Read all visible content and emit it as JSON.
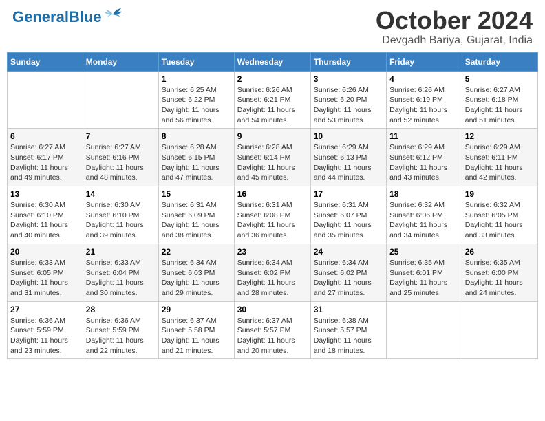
{
  "header": {
    "logo_general": "General",
    "logo_blue": "Blue",
    "title": "October 2024",
    "location": "Devgadh Bariya, Gujarat, India"
  },
  "calendar": {
    "days_of_week": [
      "Sunday",
      "Monday",
      "Tuesday",
      "Wednesday",
      "Thursday",
      "Friday",
      "Saturday"
    ],
    "weeks": [
      [
        {
          "day": "",
          "sunrise": "",
          "sunset": "",
          "daylight": ""
        },
        {
          "day": "",
          "sunrise": "",
          "sunset": "",
          "daylight": ""
        },
        {
          "day": "1",
          "sunrise": "Sunrise: 6:25 AM",
          "sunset": "Sunset: 6:22 PM",
          "daylight": "Daylight: 11 hours and 56 minutes."
        },
        {
          "day": "2",
          "sunrise": "Sunrise: 6:26 AM",
          "sunset": "Sunset: 6:21 PM",
          "daylight": "Daylight: 11 hours and 54 minutes."
        },
        {
          "day": "3",
          "sunrise": "Sunrise: 6:26 AM",
          "sunset": "Sunset: 6:20 PM",
          "daylight": "Daylight: 11 hours and 53 minutes."
        },
        {
          "day": "4",
          "sunrise": "Sunrise: 6:26 AM",
          "sunset": "Sunset: 6:19 PM",
          "daylight": "Daylight: 11 hours and 52 minutes."
        },
        {
          "day": "5",
          "sunrise": "Sunrise: 6:27 AM",
          "sunset": "Sunset: 6:18 PM",
          "daylight": "Daylight: 11 hours and 51 minutes."
        }
      ],
      [
        {
          "day": "6",
          "sunrise": "Sunrise: 6:27 AM",
          "sunset": "Sunset: 6:17 PM",
          "daylight": "Daylight: 11 hours and 49 minutes."
        },
        {
          "day": "7",
          "sunrise": "Sunrise: 6:27 AM",
          "sunset": "Sunset: 6:16 PM",
          "daylight": "Daylight: 11 hours and 48 minutes."
        },
        {
          "day": "8",
          "sunrise": "Sunrise: 6:28 AM",
          "sunset": "Sunset: 6:15 PM",
          "daylight": "Daylight: 11 hours and 47 minutes."
        },
        {
          "day": "9",
          "sunrise": "Sunrise: 6:28 AM",
          "sunset": "Sunset: 6:14 PM",
          "daylight": "Daylight: 11 hours and 45 minutes."
        },
        {
          "day": "10",
          "sunrise": "Sunrise: 6:29 AM",
          "sunset": "Sunset: 6:13 PM",
          "daylight": "Daylight: 11 hours and 44 minutes."
        },
        {
          "day": "11",
          "sunrise": "Sunrise: 6:29 AM",
          "sunset": "Sunset: 6:12 PM",
          "daylight": "Daylight: 11 hours and 43 minutes."
        },
        {
          "day": "12",
          "sunrise": "Sunrise: 6:29 AM",
          "sunset": "Sunset: 6:11 PM",
          "daylight": "Daylight: 11 hours and 42 minutes."
        }
      ],
      [
        {
          "day": "13",
          "sunrise": "Sunrise: 6:30 AM",
          "sunset": "Sunset: 6:10 PM",
          "daylight": "Daylight: 11 hours and 40 minutes."
        },
        {
          "day": "14",
          "sunrise": "Sunrise: 6:30 AM",
          "sunset": "Sunset: 6:10 PM",
          "daylight": "Daylight: 11 hours and 39 minutes."
        },
        {
          "day": "15",
          "sunrise": "Sunrise: 6:31 AM",
          "sunset": "Sunset: 6:09 PM",
          "daylight": "Daylight: 11 hours and 38 minutes."
        },
        {
          "day": "16",
          "sunrise": "Sunrise: 6:31 AM",
          "sunset": "Sunset: 6:08 PM",
          "daylight": "Daylight: 11 hours and 36 minutes."
        },
        {
          "day": "17",
          "sunrise": "Sunrise: 6:31 AM",
          "sunset": "Sunset: 6:07 PM",
          "daylight": "Daylight: 11 hours and 35 minutes."
        },
        {
          "day": "18",
          "sunrise": "Sunrise: 6:32 AM",
          "sunset": "Sunset: 6:06 PM",
          "daylight": "Daylight: 11 hours and 34 minutes."
        },
        {
          "day": "19",
          "sunrise": "Sunrise: 6:32 AM",
          "sunset": "Sunset: 6:05 PM",
          "daylight": "Daylight: 11 hours and 33 minutes."
        }
      ],
      [
        {
          "day": "20",
          "sunrise": "Sunrise: 6:33 AM",
          "sunset": "Sunset: 6:05 PM",
          "daylight": "Daylight: 11 hours and 31 minutes."
        },
        {
          "day": "21",
          "sunrise": "Sunrise: 6:33 AM",
          "sunset": "Sunset: 6:04 PM",
          "daylight": "Daylight: 11 hours and 30 minutes."
        },
        {
          "day": "22",
          "sunrise": "Sunrise: 6:34 AM",
          "sunset": "Sunset: 6:03 PM",
          "daylight": "Daylight: 11 hours and 29 minutes."
        },
        {
          "day": "23",
          "sunrise": "Sunrise: 6:34 AM",
          "sunset": "Sunset: 6:02 PM",
          "daylight": "Daylight: 11 hours and 28 minutes."
        },
        {
          "day": "24",
          "sunrise": "Sunrise: 6:34 AM",
          "sunset": "Sunset: 6:02 PM",
          "daylight": "Daylight: 11 hours and 27 minutes."
        },
        {
          "day": "25",
          "sunrise": "Sunrise: 6:35 AM",
          "sunset": "Sunset: 6:01 PM",
          "daylight": "Daylight: 11 hours and 25 minutes."
        },
        {
          "day": "26",
          "sunrise": "Sunrise: 6:35 AM",
          "sunset": "Sunset: 6:00 PM",
          "daylight": "Daylight: 11 hours and 24 minutes."
        }
      ],
      [
        {
          "day": "27",
          "sunrise": "Sunrise: 6:36 AM",
          "sunset": "Sunset: 5:59 PM",
          "daylight": "Daylight: 11 hours and 23 minutes."
        },
        {
          "day": "28",
          "sunrise": "Sunrise: 6:36 AM",
          "sunset": "Sunset: 5:59 PM",
          "daylight": "Daylight: 11 hours and 22 minutes."
        },
        {
          "day": "29",
          "sunrise": "Sunrise: 6:37 AM",
          "sunset": "Sunset: 5:58 PM",
          "daylight": "Daylight: 11 hours and 21 minutes."
        },
        {
          "day": "30",
          "sunrise": "Sunrise: 6:37 AM",
          "sunset": "Sunset: 5:57 PM",
          "daylight": "Daylight: 11 hours and 20 minutes."
        },
        {
          "day": "31",
          "sunrise": "Sunrise: 6:38 AM",
          "sunset": "Sunset: 5:57 PM",
          "daylight": "Daylight: 11 hours and 18 minutes."
        },
        {
          "day": "",
          "sunrise": "",
          "sunset": "",
          "daylight": ""
        },
        {
          "day": "",
          "sunrise": "",
          "sunset": "",
          "daylight": ""
        }
      ]
    ]
  }
}
